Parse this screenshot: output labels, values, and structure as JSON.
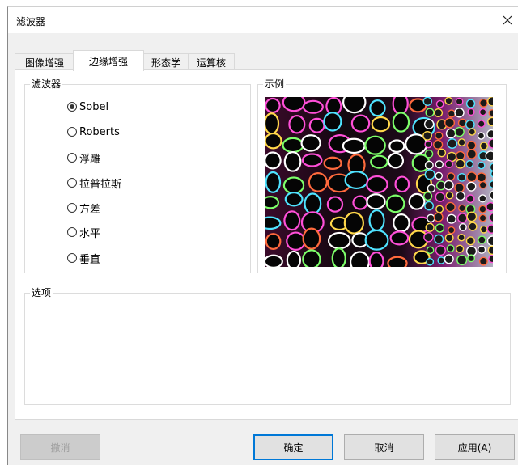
{
  "dialog": {
    "title": "滤波器"
  },
  "tabs": [
    {
      "label": "图像增强"
    },
    {
      "label": "边缘增强"
    },
    {
      "label": "形态学"
    },
    {
      "label": "运算核"
    }
  ],
  "filter_group": {
    "legend": "滤波器",
    "options": [
      {
        "label": "Sobel",
        "selected": true
      },
      {
        "label": "Roberts",
        "selected": false
      },
      {
        "label": "浮雕",
        "selected": false
      },
      {
        "label": "拉普拉斯",
        "selected": false
      },
      {
        "label": "方差",
        "selected": false
      },
      {
        "label": "水平",
        "selected": false
      },
      {
        "label": "垂直",
        "selected": false
      }
    ]
  },
  "example_group": {
    "legend": "示例"
  },
  "options_group": {
    "legend": "选项"
  },
  "buttons": {
    "undo": "撤消",
    "ok": "确定",
    "cancel": "取消",
    "apply": "应用(A)"
  }
}
